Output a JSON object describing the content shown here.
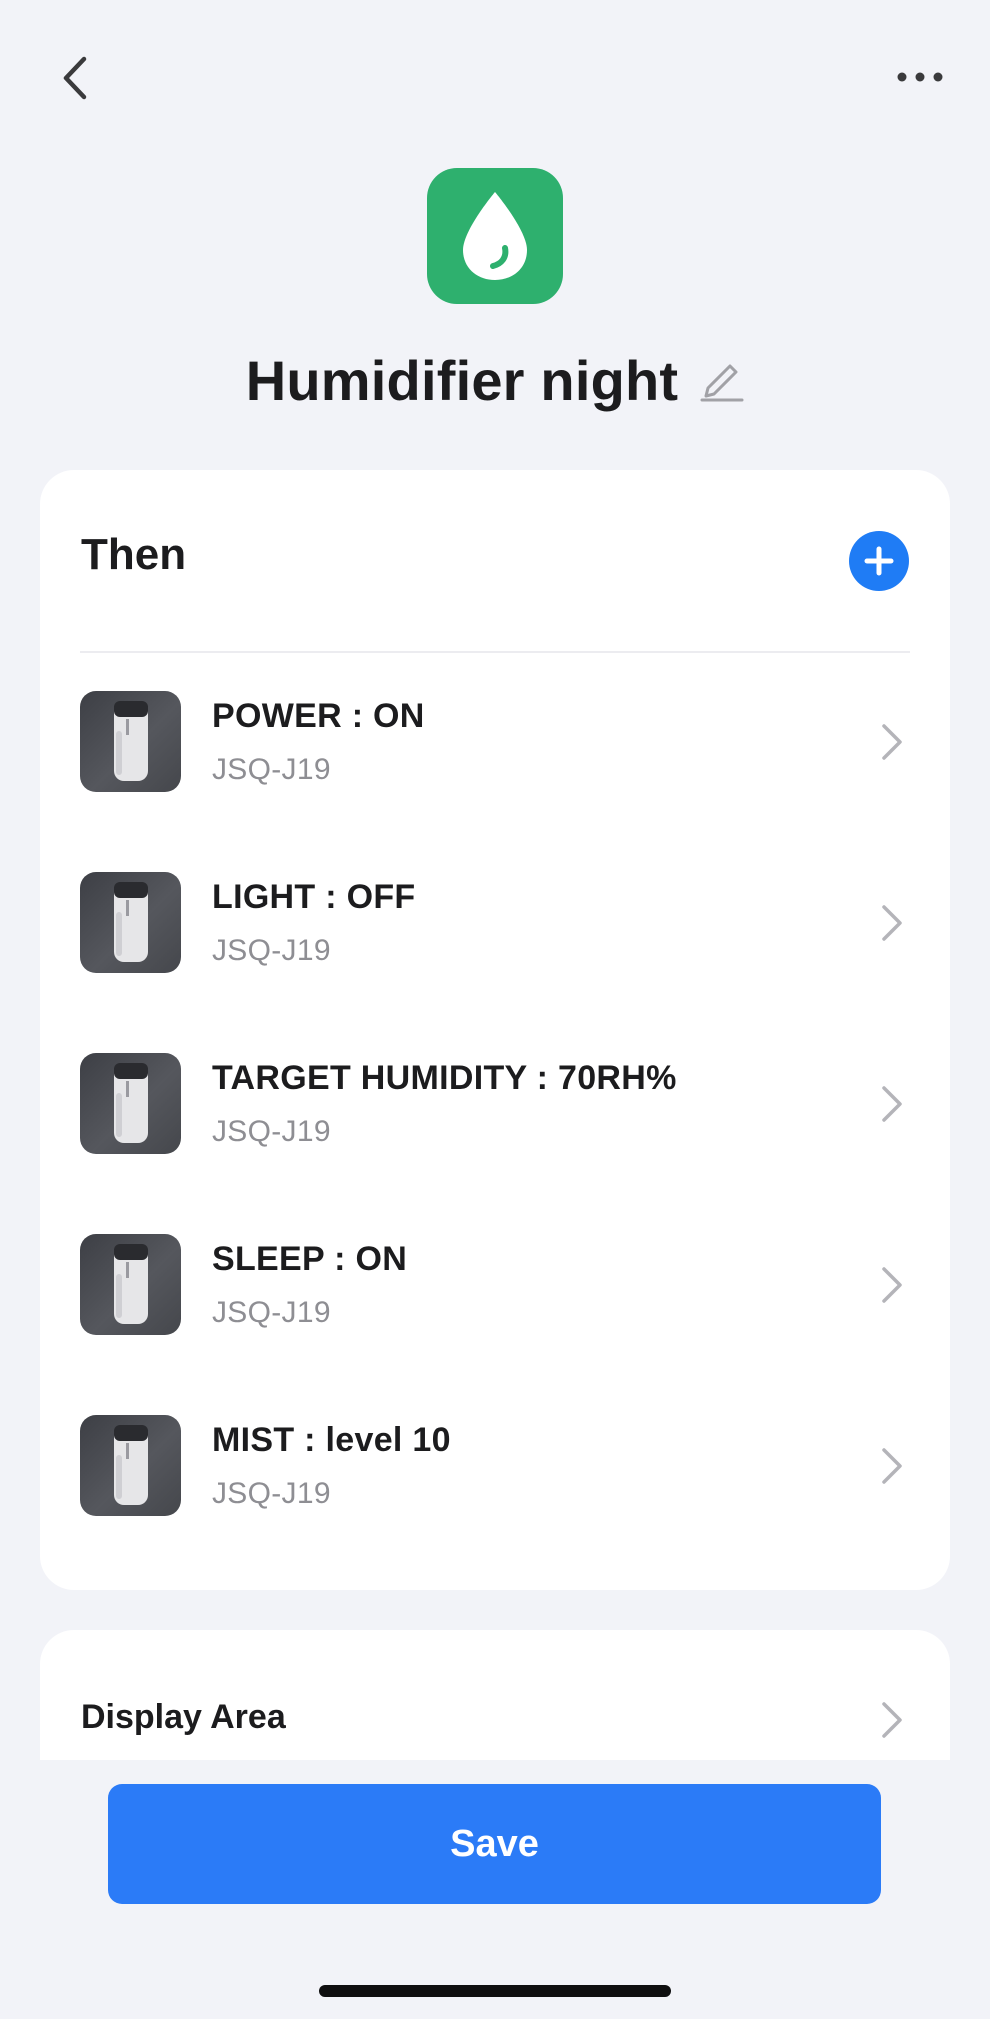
{
  "header": {
    "back_icon": "chevron-left-icon",
    "more_icon": "more-horizontal-icon"
  },
  "scene": {
    "icon": "water-drop-icon",
    "icon_color": "#2eb06e",
    "title": "Humidifier night",
    "edit_icon": "pencil-icon"
  },
  "then_section": {
    "label": "Then",
    "add_icon": "plus-circle-icon",
    "accent": "#1f7cf5",
    "actions": [
      {
        "title": "POWER : ON",
        "device": "JSQ-J19"
      },
      {
        "title": "LIGHT : OFF",
        "device": "JSQ-J19"
      },
      {
        "title": "TARGET HUMIDITY : 70RH%",
        "device": "JSQ-J19"
      },
      {
        "title": "SLEEP : ON",
        "device": "JSQ-J19"
      },
      {
        "title": "MIST : level 10",
        "device": "JSQ-J19"
      }
    ]
  },
  "display_area": {
    "label": "Display Area"
  },
  "footer": {
    "save_label": "Save",
    "save_color": "#2b7bf7"
  }
}
